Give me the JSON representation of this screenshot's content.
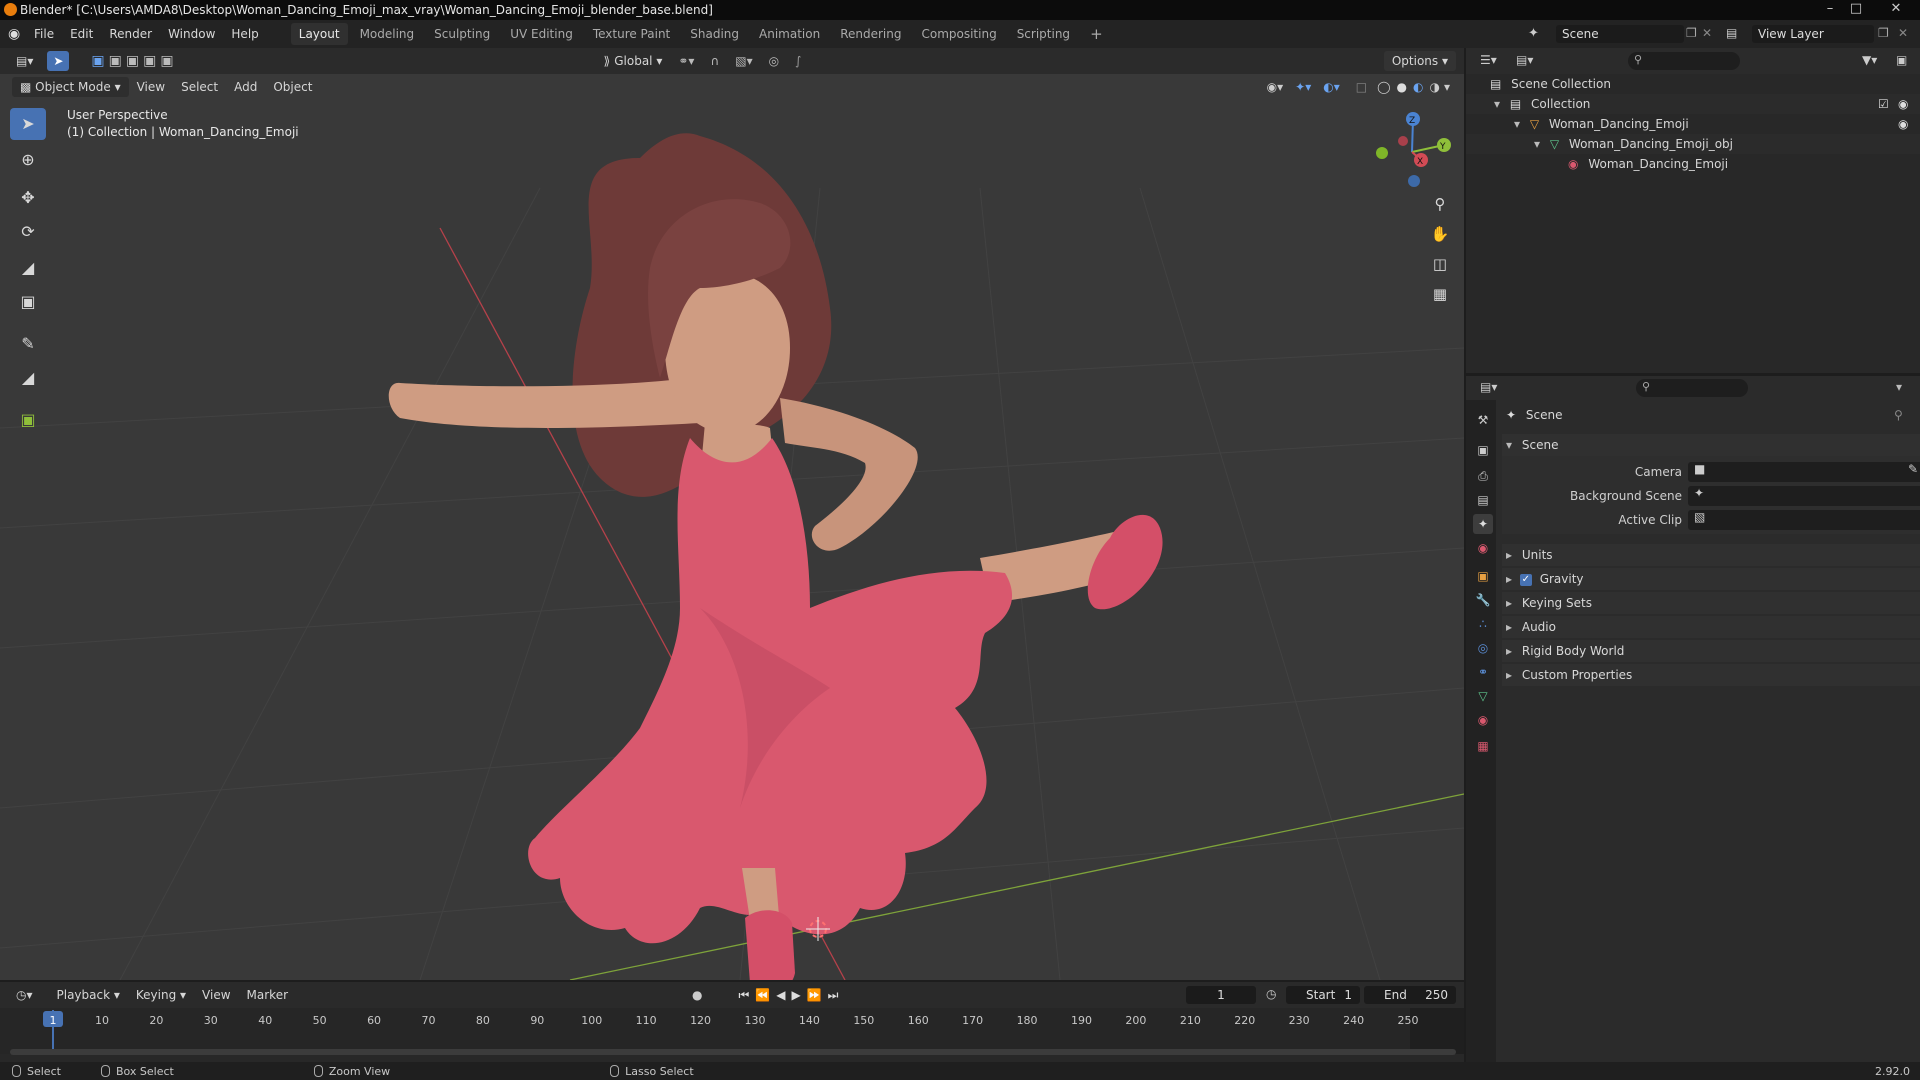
{
  "window": {
    "title": "Blender* [C:\\Users\\AMDA8\\Desktop\\Woman_Dancing_Emoji_max_vray\\Woman_Dancing_Emoji_blender_base.blend]",
    "minimize": "–",
    "maximize": "□",
    "close": "✕"
  },
  "menubar": {
    "items": [
      "File",
      "Edit",
      "Render",
      "Window",
      "Help"
    ]
  },
  "workspaces": [
    "Layout",
    "Modeling",
    "Sculpting",
    "UV Editing",
    "Texture Paint",
    "Shading",
    "Animation",
    "Rendering",
    "Compositing",
    "Scripting"
  ],
  "workspace_add": "+",
  "scene_selector": {
    "value": "Scene"
  },
  "viewlayer_selector": {
    "value": "View Layer"
  },
  "viewport": {
    "mode": "Object Mode",
    "menus": [
      "View",
      "Select",
      "Add",
      "Object"
    ],
    "transform_orientation": "Global",
    "options_label": "Options",
    "overlay_line1": "User Perspective",
    "overlay_line2": "(1) Collection | Woman_Dancing_Emoji",
    "gizmo": {
      "z": "Z",
      "y": "Y",
      "x": "X"
    }
  },
  "outliner": {
    "rows": [
      {
        "label": "Scene Collection"
      },
      {
        "label": "Collection"
      },
      {
        "label": "Woman_Dancing_Emoji"
      },
      {
        "label": "Woman_Dancing_Emoji_obj"
      },
      {
        "label": "Woman_Dancing_Emoji"
      }
    ]
  },
  "properties": {
    "context_label": "Scene",
    "panel_title": "Scene",
    "fields": [
      {
        "label": "Camera"
      },
      {
        "label": "Background Scene"
      },
      {
        "label": "Active Clip"
      }
    ],
    "subpanels": [
      "Units",
      "Gravity",
      "Keying Sets",
      "Audio",
      "Rigid Body World",
      "Custom Properties"
    ],
    "gravity_checked": true
  },
  "timeline": {
    "menus": [
      "Playback",
      "Keying",
      "View",
      "Marker"
    ],
    "current_frame": "1",
    "start_label": "Start",
    "start_value": "1",
    "end_label": "End",
    "end_value": "250",
    "ticks": [
      "1",
      "10",
      "20",
      "30",
      "40",
      "50",
      "60",
      "70",
      "80",
      "90",
      "100",
      "110",
      "120",
      "130",
      "140",
      "150",
      "160",
      "170",
      "180",
      "190",
      "200",
      "210",
      "220",
      "230",
      "240",
      "250"
    ]
  },
  "statusbar": {
    "select": "Select",
    "box_select": "Box Select",
    "zoom_view": "Zoom View",
    "lasso_select": "Lasso Select",
    "version": "2.92.0"
  },
  "colors": {
    "accent": "#4772b3",
    "dress": "#d9586e",
    "skin": "#cf9c82",
    "hair": "#6e3a38",
    "x_axis": "#d24b55",
    "y_axis": "#8fbf3a",
    "z_axis": "#4a83d2"
  }
}
